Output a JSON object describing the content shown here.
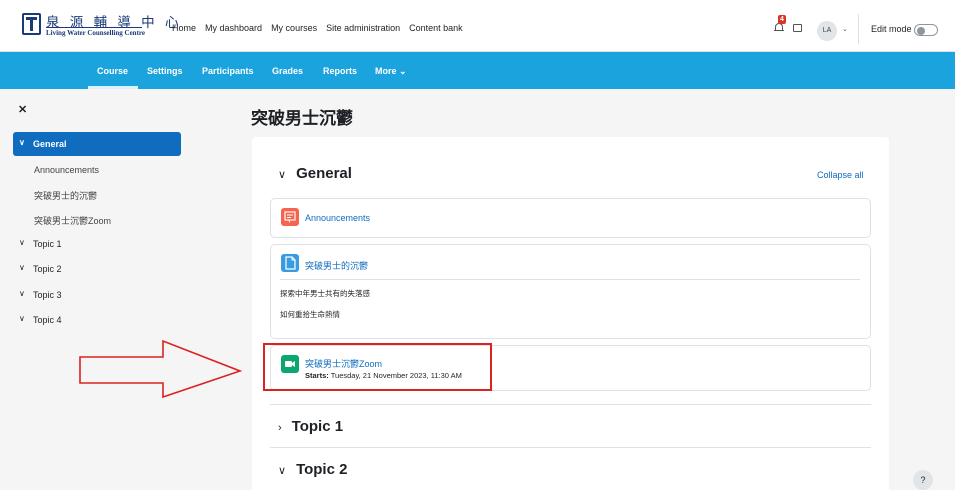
{
  "brand": {
    "name_cn": "泉 源 輔 導 中 心",
    "name_en": "Living Water Counselling Centre"
  },
  "topnav": [
    "Home",
    "My dashboard",
    "My courses",
    "Site administration",
    "Content bank"
  ],
  "notifications": {
    "count": "4"
  },
  "user": {
    "initials": "LA"
  },
  "edit_mode": {
    "label": "Edit mode",
    "on": false
  },
  "secondary_nav": [
    "Course",
    "Settings",
    "Participants",
    "Grades",
    "Reports",
    "More ⌄"
  ],
  "course": {
    "title": "突破男士沉鬱"
  },
  "drawer": {
    "active": "General",
    "subitems": [
      "Announcements",
      "突破男士的沉鬱",
      "突破男士沉鬱Zoom"
    ],
    "topics": [
      "Topic 1",
      "Topic 2",
      "Topic 3",
      "Topic 4"
    ]
  },
  "general": {
    "heading": "General",
    "collapse_all": "Collapse all",
    "activities": [
      {
        "title": "Announcements",
        "icon": "forum-icon"
      },
      {
        "title": "突破男士的沉鬱",
        "icon": "page-icon",
        "lines": [
          "探索中年男士共有的失落感",
          "如何重拾生命熱情"
        ]
      },
      {
        "title": "突破男士沉鬱Zoom",
        "icon": "zoom-icon",
        "starts_label": "Starts:",
        "starts_value": " Tuesday, 21 November 2023, 11:30 AM"
      }
    ]
  },
  "sections": [
    {
      "heading": "Topic 1"
    },
    {
      "heading": "Topic 2"
    }
  ],
  "help": {
    "label": "?"
  },
  "colors": {
    "accent": "#1aa3dc",
    "primary": "#0f6cbf",
    "forum": "#f7634d",
    "page": "#399be2",
    "zoom": "#0aa86e",
    "annotation": "#d9231e"
  }
}
